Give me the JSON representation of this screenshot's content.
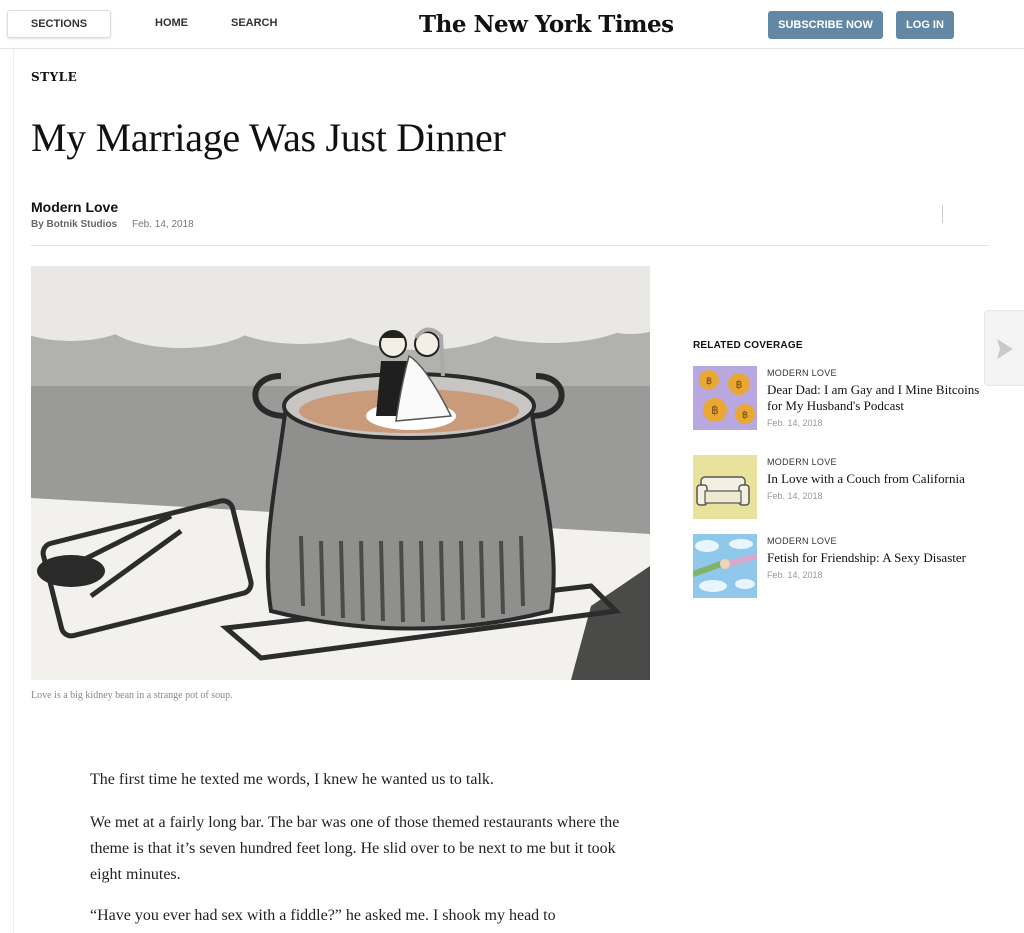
{
  "header": {
    "sections_label": "SECTIONS",
    "home_label": "HOME",
    "search_label": "SEARCH",
    "masthead": "The New York Times",
    "subscribe_label": "SUBSCRIBE NOW",
    "login_label": "LOG IN",
    "accent_color": "#6288a5"
  },
  "article": {
    "kicker": "STYLE",
    "headline": "My Marriage Was Just Dinner",
    "series": "Modern Love",
    "byline": "By Botnik Studios",
    "date": "Feb. 14, 2018",
    "caption": "Love is a big kidney bean in a strange pot of soup.",
    "paragraphs": [
      "The first time he texted me words, I knew he wanted us to talk.",
      "We met at a fairly long bar. The bar was one of those themed restaurants where the theme is that it’s seven hundred feet long. He slid over to be next to me but it took eight minutes.",
      "“Have you ever had sex with a fiddle?” he asked me. I shook my head to"
    ]
  },
  "related": {
    "heading": "RELATED COVERAGE",
    "items": [
      {
        "kicker": "MODERN LOVE",
        "title": "Dear Dad: I am Gay and I Mine Bitcoins for My Husband's Podcast",
        "date": "Feb. 14, 2018",
        "thumb_icon": "bitcoin-coins-icon"
      },
      {
        "kicker": "MODERN LOVE",
        "title": "In Love with a Couch from California",
        "date": "Feb. 14, 2018",
        "thumb_icon": "couch-icon"
      },
      {
        "kicker": "MODERN LOVE",
        "title": "Fetish for Friendship: A Sexy Disaster",
        "date": "Feb. 14, 2018",
        "thumb_icon": "holding-hands-icon"
      }
    ]
  },
  "next_arrow_icon": "next-arrow-icon"
}
